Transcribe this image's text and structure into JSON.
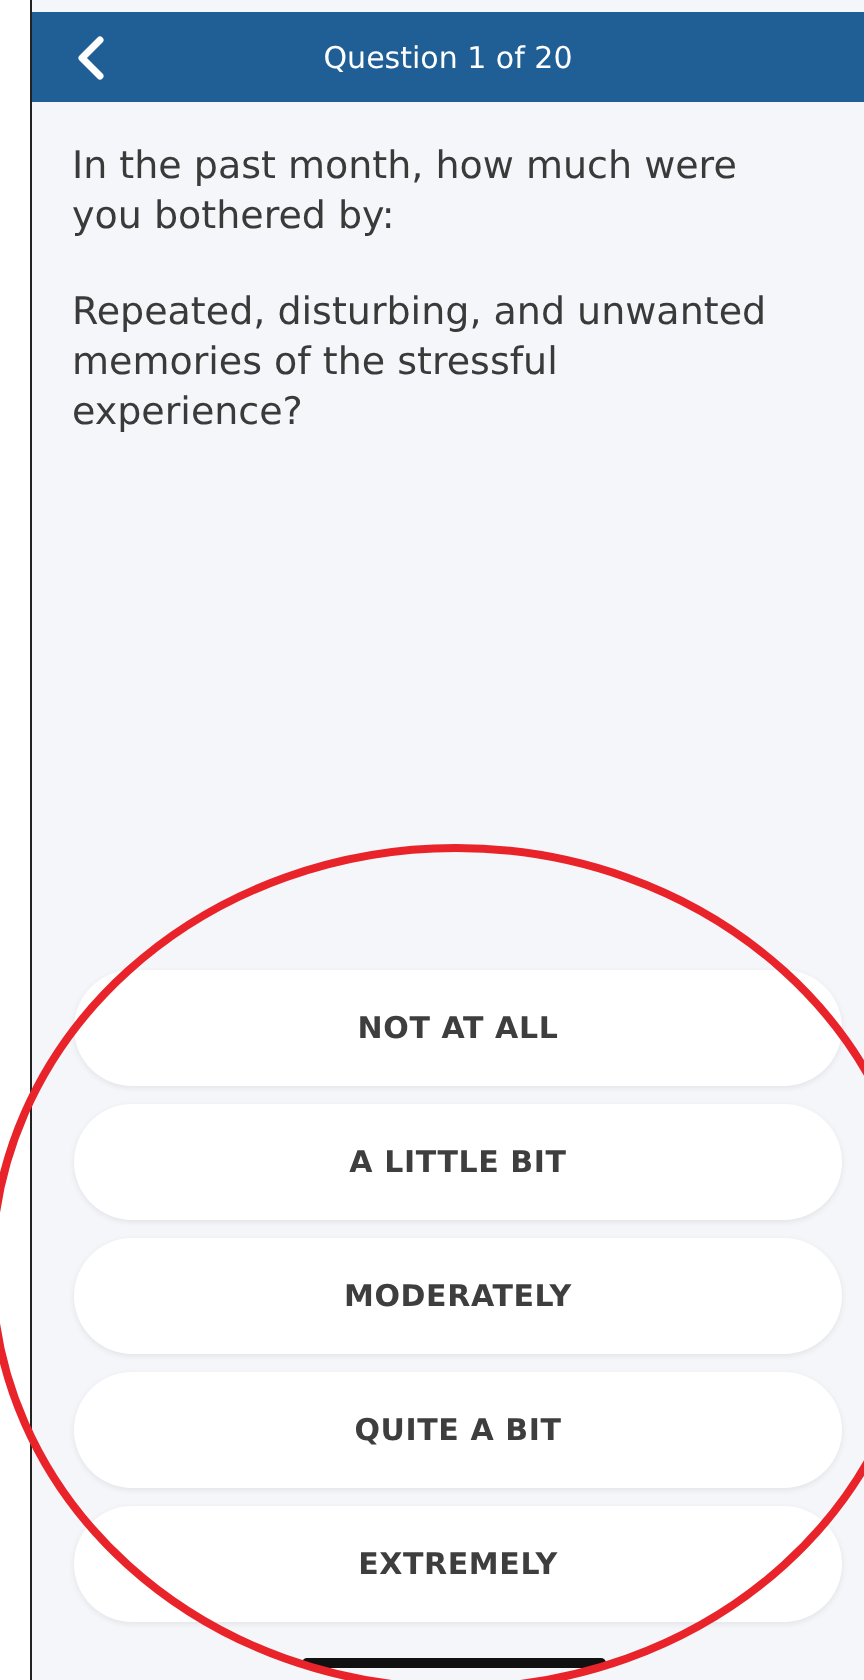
{
  "header": {
    "title": "Question 1 of 20"
  },
  "question": {
    "prompt": "In the past month, how much were you bothered by:",
    "text": "Repeated, disturbing, and unwanted memories of the stressful experience?"
  },
  "options": [
    {
      "label": "NOT AT ALL",
      "selected": false
    },
    {
      "label": "A LITTLE BIT",
      "selected": false
    },
    {
      "label": "MODERATELY",
      "selected": false
    },
    {
      "label": "QUITE A BIT",
      "selected": false
    },
    {
      "label": "EXTREMELY",
      "selected": false
    }
  ]
}
